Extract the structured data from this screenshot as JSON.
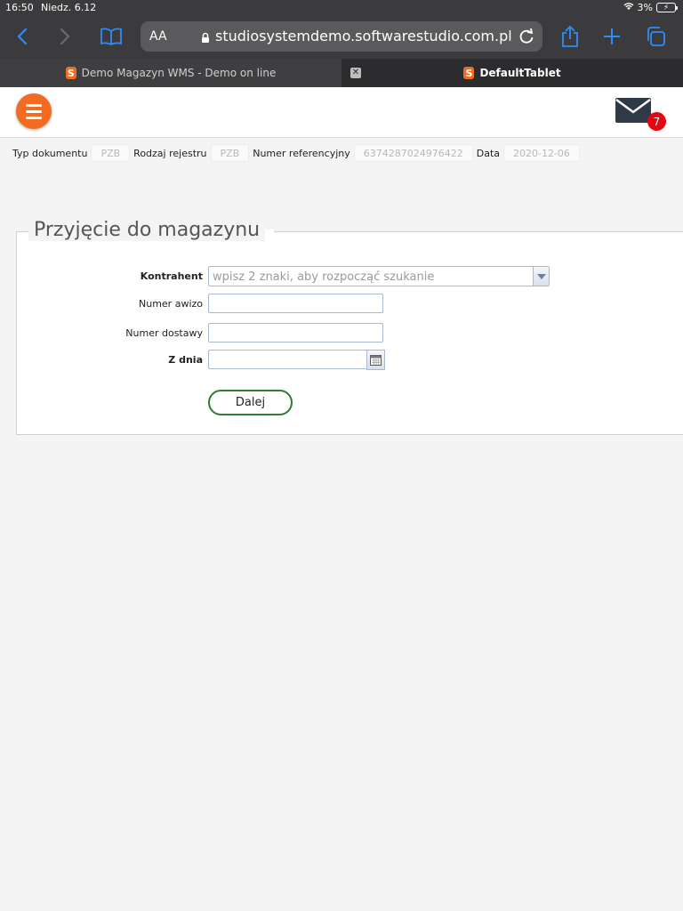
{
  "status_bar": {
    "time": "16:50",
    "date": "Niedz. 6.12",
    "battery": "3%"
  },
  "browser": {
    "text_size_label": "AA",
    "url": "studiosystemdemo.softwarestudio.com.pl",
    "tabs": [
      {
        "label": "Demo Magazyn WMS - Demo on line",
        "active": false
      },
      {
        "label": "DefaultTablet",
        "active": true
      }
    ]
  },
  "header": {
    "unread_count": "7",
    "accent_color": "#f26b21"
  },
  "doc_info": {
    "doc_type_label": "Typ dokumentu",
    "doc_type_value": "PZB",
    "register_type_label": "Rodzaj rejestru",
    "register_type_value": "PZB",
    "reference_label": "Numer referencyjny",
    "reference_value": "6374287024976422",
    "date_label": "Data",
    "date_value": "2020-12-06"
  },
  "form": {
    "title": "Przyjęcie do magazynu",
    "contractor_label": "Kontrahent",
    "contractor_placeholder": "wpisz 2 znaki, aby rozpocząć szukanie",
    "advice_label": "Numer awizo",
    "advice_value": "",
    "delivery_label": "Numer dostawy",
    "delivery_value": "",
    "date_label": "Z dnia",
    "date_value": "",
    "next_button": "Dalej"
  }
}
